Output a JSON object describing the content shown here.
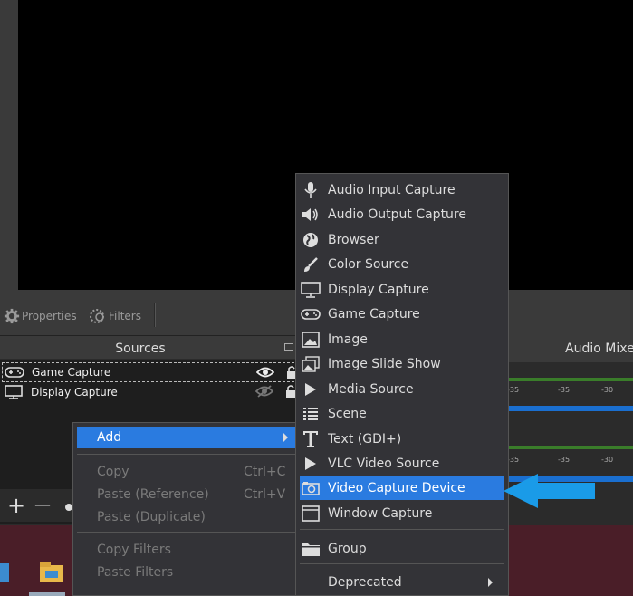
{
  "toolbar": {
    "properties_label": "Properties",
    "filters_label": "Filters"
  },
  "sources": {
    "title": "Sources",
    "items": [
      {
        "label": "Game Capture",
        "icon": "gamepad-icon",
        "visible": true,
        "selected": true
      },
      {
        "label": "Display Capture",
        "icon": "monitor-icon",
        "visible": false,
        "selected": false
      }
    ]
  },
  "bottom_controls": {
    "add": "+",
    "remove": "—"
  },
  "audio_mixer": {
    "title": "Audio Mixe",
    "db_labels": [
      "-35",
      "-30"
    ]
  },
  "context_menu": {
    "items": [
      {
        "label": "Add",
        "highlighted": true,
        "submenu": true
      },
      {
        "label": "Copy",
        "shortcut": "Ctrl+C",
        "disabled": true
      },
      {
        "label": "Paste (Reference)",
        "shortcut": "Ctrl+V",
        "disabled": true
      },
      {
        "label": "Paste (Duplicate)",
        "disabled": true
      },
      {
        "label": "Copy Filters",
        "disabled": true
      },
      {
        "label": "Paste Filters",
        "disabled": true
      }
    ]
  },
  "add_menu": {
    "items": [
      {
        "label": "Audio Input Capture",
        "icon": "microphone-icon"
      },
      {
        "label": "Audio Output Capture",
        "icon": "speaker-icon"
      },
      {
        "label": "Browser",
        "icon": "globe-icon"
      },
      {
        "label": "Color Source",
        "icon": "brush-icon"
      },
      {
        "label": "Display Capture",
        "icon": "monitor-icon"
      },
      {
        "label": "Game Capture",
        "icon": "gamepad-icon"
      },
      {
        "label": "Image",
        "icon": "image-icon"
      },
      {
        "label": "Image Slide Show",
        "icon": "slideshow-icon"
      },
      {
        "label": "Media Source",
        "icon": "play-icon"
      },
      {
        "label": "Scene",
        "icon": "list-icon"
      },
      {
        "label": "Text (GDI+)",
        "icon": "text-icon"
      },
      {
        "label": "VLC Video Source",
        "icon": "play-icon"
      },
      {
        "label": "Video Capture Device",
        "icon": "camera-icon",
        "highlighted": true
      },
      {
        "label": "Window Capture",
        "icon": "window-icon"
      },
      {
        "label": "Group",
        "icon": "folder-icon"
      },
      {
        "label": "Deprecated",
        "icon": "",
        "submenu": true
      }
    ]
  },
  "colors": {
    "menu_bg": "#333337",
    "highlight": "#2a7be0",
    "annotation_arrow": "#1a9be8",
    "meter_green": "#3a7d2a",
    "meter_blue": "#1a6fd0"
  }
}
